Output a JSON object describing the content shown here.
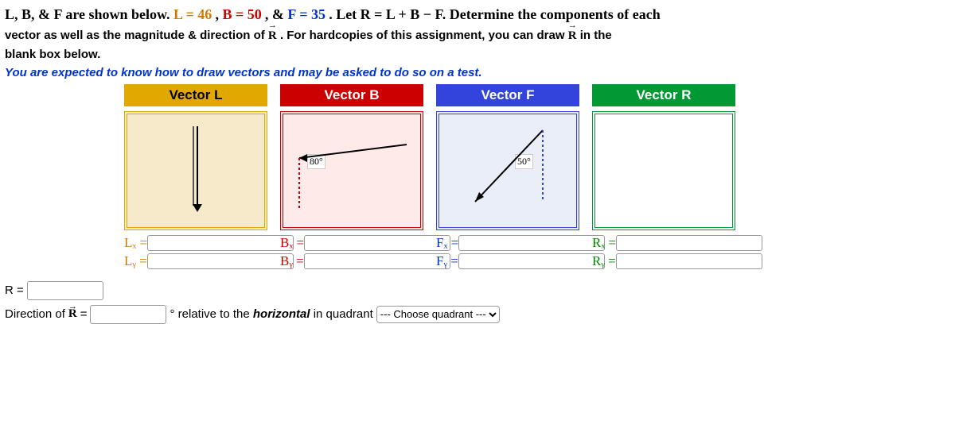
{
  "intro": {
    "prefix": "L, B, & F are shown below. ",
    "l_expr": "L = 46",
    "sep1": ", ",
    "b_expr": "B = 50",
    "sep2": ", & ",
    "f_expr": "F = 35",
    "period": ". ",
    "let_r": "Let R = L + B − F. Determine the components of each",
    "line2a": "vector as well as the magnitude & direction of ",
    "r_letter": "R",
    "line2b": ". For hardcopies of this assignment, you can draw ",
    "line2c": " in the",
    "line3": "blank box below."
  },
  "test_note": "You are expected to know how to draw vectors and may be asked to do so on a test.",
  "headers": {
    "l": "Vector L",
    "b": "Vector B",
    "f": "Vector F",
    "r": "Vector R"
  },
  "angles": {
    "b": "80°",
    "f": "50°"
  },
  "labels": {
    "lx": "Lₓ =",
    "ly": "Lᵧ =",
    "bx": "Bₓ =",
    "by": "Bᵧ =",
    "fx": "Fₓ =",
    "fy": "Fᵧ =",
    "rx": "Rₓ =",
    "ry": "Rᵧ ="
  },
  "bottom": {
    "r_eq": "R =",
    "dir_pre": "Direction of ",
    "dir_post": " =",
    "rel": "° relative to the ",
    "horiz": "horizontal",
    "inquad": " in quadrant",
    "select_placeholder": "--- Choose quadrant ---"
  }
}
